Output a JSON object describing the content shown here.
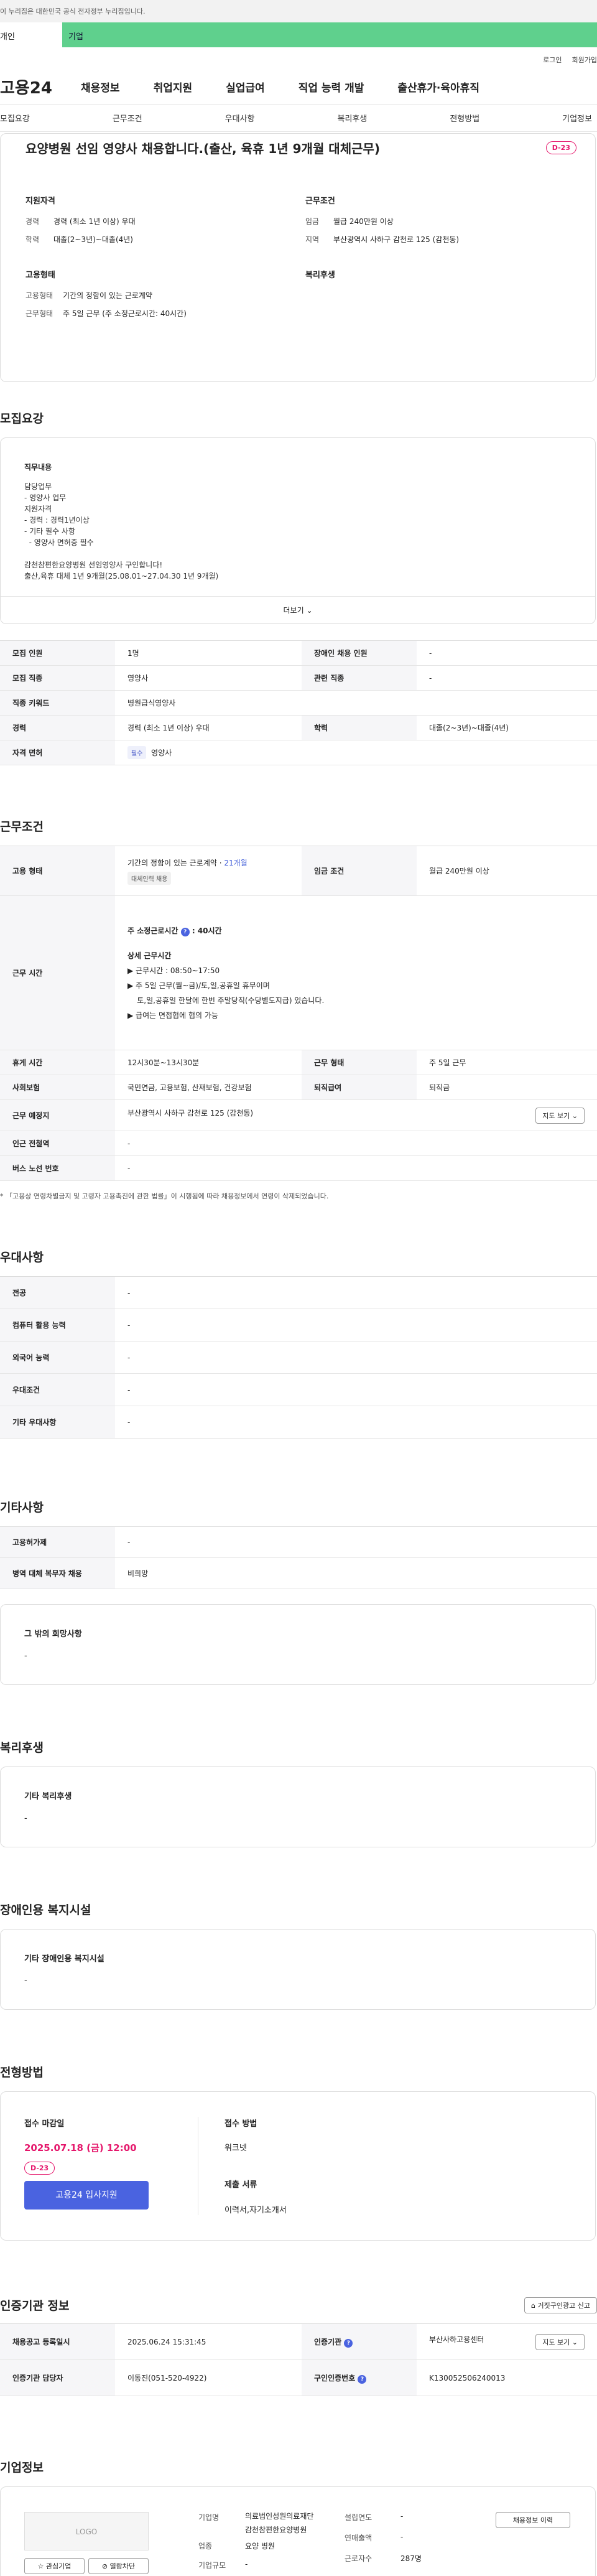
{
  "gov_notice": "이 누리집은 대한민국 공식 전자정부 누리집입니다.",
  "tabs": [
    "개인",
    "기업"
  ],
  "top_links": [
    "로그인",
    "회원가입"
  ],
  "logo": "고용24",
  "gnb": [
    "채용정보",
    "취업지원",
    "실업급여",
    "직업 능력 개발",
    "출산휴가·육아휴직"
  ],
  "anchors": [
    "모집요강",
    "근무조건",
    "우대사항",
    "복리후생",
    "전형방법",
    "기업정보"
  ],
  "summary": {
    "title": "요양병원 선임 영양사 채용합니다.(출산, 육휴 1년 9개월 대체근무)",
    "dday": "D-23",
    "qual_title": "지원자격",
    "qual": [
      {
        "k": "경력",
        "v": "경력 (최소 1년 이상) 우대"
      },
      {
        "k": "학력",
        "v": "대졸(2~3년)~대졸(4년)"
      }
    ],
    "cond_title": "근무조건",
    "cond": [
      {
        "k": "임금",
        "v": "월급 240만원 이상"
      },
      {
        "k": "지역",
        "v": "부산광역시 사하구 감천로 125 (감천동)"
      }
    ],
    "emp_title": "고용형태",
    "emp": [
      {
        "k": "고용형태",
        "v": "기간의 정함이 있는 근로계약"
      },
      {
        "k": "근무형태",
        "v": "주 5일 근무 (주 소정근로시간: 40시간)"
      }
    ],
    "welfare_title": "복리후생"
  },
  "recruit": {
    "title": "모집요강",
    "duty_title": "직무내용",
    "duty_lines": [
      "담당업무",
      "- 영양사 업무",
      "지원자격",
      "- 경력 : 경력1년이상",
      "- 기타 필수 사항",
      "  - 영양사 면허증 필수",
      "",
      "감천참편한요양병원 선임영양사 구인합니다!",
      "출산,육휴 대체 1년 9개월(25.08.01~27.04.30 1년 9개월)"
    ],
    "more": "더보기",
    "rows": [
      {
        "k1": "모집 인원",
        "v1": "1명",
        "k2": "장애인 채용 인원",
        "v2": "-"
      },
      {
        "k1": "모집 직종",
        "v1": "영양사",
        "k2": "관련 직종",
        "v2": "-"
      },
      {
        "k1": "직종 키워드",
        "v1": "병원급식영양사"
      },
      {
        "k1": "경력",
        "v1": "경력 (최소 1년 이상) 우대",
        "k2": "학력",
        "v2": "대졸(2~3년)~대졸(4년)"
      },
      {
        "k1": "자격 면허",
        "pill": "필수",
        "v1": "영양사"
      }
    ]
  },
  "work": {
    "title": "근무조건",
    "emp_k": "고용 형태",
    "emp_v": "기간의 정함이 있는 근로계약 · ",
    "emp_months": "21개월",
    "emp_pill": "대체인력 채용",
    "wage_k": "임금 조건",
    "wage_v": "월급 240만원 이상",
    "hours_k": "근무 시간",
    "hours_lines": [
      "주 소정근로시간",
      "40시간"
    ],
    "detail_title": "상세 근무시간",
    "detail_lines": [
      "▶ 근무시간 : 08:50~17:50",
      "▶ 주 5일 근무(월~금)/토,일,공휴일 휴무이며",
      "    토,일,공휴일 한달에 한번 주말당직(수당별도지급) 있습니다.",
      "▶ 급여는 면접협에 협의 가능"
    ],
    "rows": [
      {
        "k1": "휴게 시간",
        "v1": "12시30분~13시30분",
        "k2": "근무 형태",
        "v2": "주 5일 근무"
      },
      {
        "k1": "사회보험",
        "v1": "국민연금, 고용보험, 산재보험, 건강보험",
        "k2": "퇴직급여",
        "v2": "퇴직금"
      },
      {
        "k1": "근무 예정지",
        "v1": "부산광역시 사하구 감천로 125 (감천동)",
        "btn": "지도 보기"
      },
      {
        "k1": "인근 전철역",
        "v1": "-"
      },
      {
        "k1": "버스 노선 번호",
        "v1": "-"
      }
    ],
    "notice": "* 「고용상 연령차별금지 및 고령자 고용촉진에 관한 법률」이 시행됨에 따라 채용정보에서 연령이 삭제되었습니다."
  },
  "pref": {
    "title": "우대사항",
    "rows": [
      {
        "k": "전공",
        "v": "-"
      },
      {
        "k": "컴퓨터 활용 능력",
        "v": "-"
      },
      {
        "k": "외국어 능력",
        "v": "-"
      },
      {
        "k": "우대조건",
        "v": "-"
      },
      {
        "k": "기타 우대사항",
        "v": "-"
      }
    ]
  },
  "etc": {
    "title": "기타사항",
    "rows": [
      {
        "k": "고용허가제",
        "v": "-"
      },
      {
        "k": "병역 대체 복무자 채용",
        "v": "비희망"
      }
    ],
    "other_title": "그 밖의 희망사항",
    "other_v": "-"
  },
  "welfare": {
    "title": "복리후생",
    "box_title": "기타 복리후생",
    "box_v": "-"
  },
  "disabled": {
    "title": "장애인용 복지시설",
    "box_title": "기타 장애인용 복지시설",
    "box_v": "-"
  },
  "selection": {
    "title": "전형방법",
    "deadline_k": "접수 마감일",
    "deadline_v": "2025.07.18 (금) 12:00",
    "dday": "D-23",
    "apply": "고용24 입사지원",
    "method_k": "접수 방법",
    "method_v": "워크넷",
    "docs_k": "제출 서류",
    "docs_v": "이력서,자기소개서"
  },
  "cert": {
    "title": "인증기관 정보",
    "report_btn": "거짓구인광고 신고",
    "rows": [
      {
        "k1": "채용공고 등록일시",
        "v1": "2025.06.24 15:31:45",
        "k2": "인증기관",
        "v2": "부산사하고용센터",
        "btn": "지도 보기"
      },
      {
        "k1": "인증기관 담당자",
        "v1": "이동진(051-520-4922)",
        "k2": "구인인증번호",
        "v2": "K130052506240013"
      }
    ]
  },
  "company": {
    "title": "기업정보",
    "logo_text": "LOGO",
    "fav_btn": "관심기업",
    "block_btn": "열람차단",
    "job_btn": "채용정보 이력",
    "fields": [
      {
        "k": "기업명",
        "v": "의료법인성원의료재단감천참편한요양병원"
      },
      {
        "k": "업종",
        "v": "요양 병원"
      },
      {
        "k": "기업규모",
        "v": "-"
      }
    ],
    "fields2": [
      {
        "k": "설립연도",
        "v": "-"
      },
      {
        "k": "연매출액",
        "v": "-"
      },
      {
        "k": "근로자수",
        "v": "287명"
      }
    ]
  }
}
